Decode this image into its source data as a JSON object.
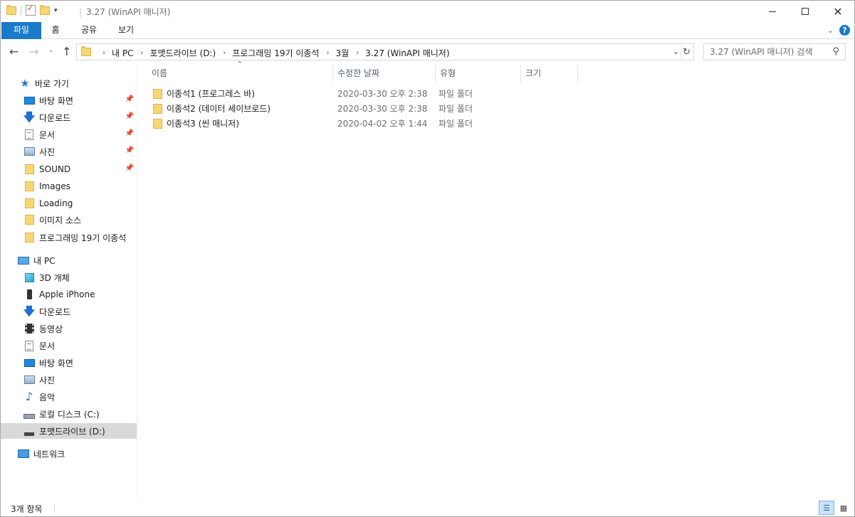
{
  "window": {
    "title": "3.27 (WinAPI 매니저)"
  },
  "ribbon": {
    "tabs": [
      "파일",
      "홈",
      "공유",
      "보기"
    ]
  },
  "address": {
    "crumbs": [
      "내 PC",
      "포맷드라이브 (D:)",
      "프로그래밍 19기 이종석",
      "3월",
      "3.27 (WinAPI 매니저)"
    ]
  },
  "search": {
    "placeholder": "3.27 (WinAPI 매니저) 검색"
  },
  "sidebar": {
    "quick_access_label": "바로 가기",
    "quick_items": [
      {
        "label": "바탕 화면",
        "icon": "desktop-icon",
        "pinned": true
      },
      {
        "label": "다운로드",
        "icon": "download-icon",
        "pinned": true
      },
      {
        "label": "문서",
        "icon": "document-icon",
        "pinned": true
      },
      {
        "label": "사진",
        "icon": "pictures-icon",
        "pinned": true
      },
      {
        "label": "SOUND",
        "icon": "folder-icon",
        "pinned": true
      },
      {
        "label": "Images",
        "icon": "folder-icon",
        "pinned": false
      },
      {
        "label": "Loading",
        "icon": "folder-icon",
        "pinned": false
      },
      {
        "label": "이미지 소스",
        "icon": "folder-icon",
        "pinned": false
      },
      {
        "label": "프로그래밍 19기 이종석",
        "icon": "folder-icon",
        "pinned": false
      }
    ],
    "pc_label": "내 PC",
    "pc_items": [
      {
        "label": "3D 개체",
        "icon": "3d-objects-icon"
      },
      {
        "label": "Apple iPhone",
        "icon": "phone-icon"
      },
      {
        "label": "다운로드",
        "icon": "download-icon"
      },
      {
        "label": "동영상",
        "icon": "video-icon"
      },
      {
        "label": "문서",
        "icon": "document-icon"
      },
      {
        "label": "바탕 화면",
        "icon": "desktop-icon"
      },
      {
        "label": "사진",
        "icon": "pictures-icon"
      },
      {
        "label": "음악",
        "icon": "music-icon"
      },
      {
        "label": "로컬 디스크 (C:)",
        "icon": "disk-icon"
      },
      {
        "label": "포맷드라이브 (D:)",
        "icon": "drive-icon"
      }
    ],
    "network_label": "네트워크"
  },
  "columns": {
    "name": "이름",
    "date": "수정한 날짜",
    "type": "유형",
    "size": "크기"
  },
  "files": [
    {
      "name": "이종석1 (프로그레스 바)",
      "date": "2020-03-30 오후 2:38",
      "type": "파일 폴더"
    },
    {
      "name": "이종석2 (데이터 세이브로드)",
      "date": "2020-03-30 오후 2:38",
      "type": "파일 폴더"
    },
    {
      "name": "이종석3 (씬 매니저)",
      "date": "2020-04-02 오후 1:44",
      "type": "파일 폴더"
    }
  ],
  "status": {
    "item_count": "3개 항목"
  },
  "colors": {
    "accent": "#1979ca",
    "folder": "#f7d774",
    "selected_bg": "#d9d9d9"
  }
}
